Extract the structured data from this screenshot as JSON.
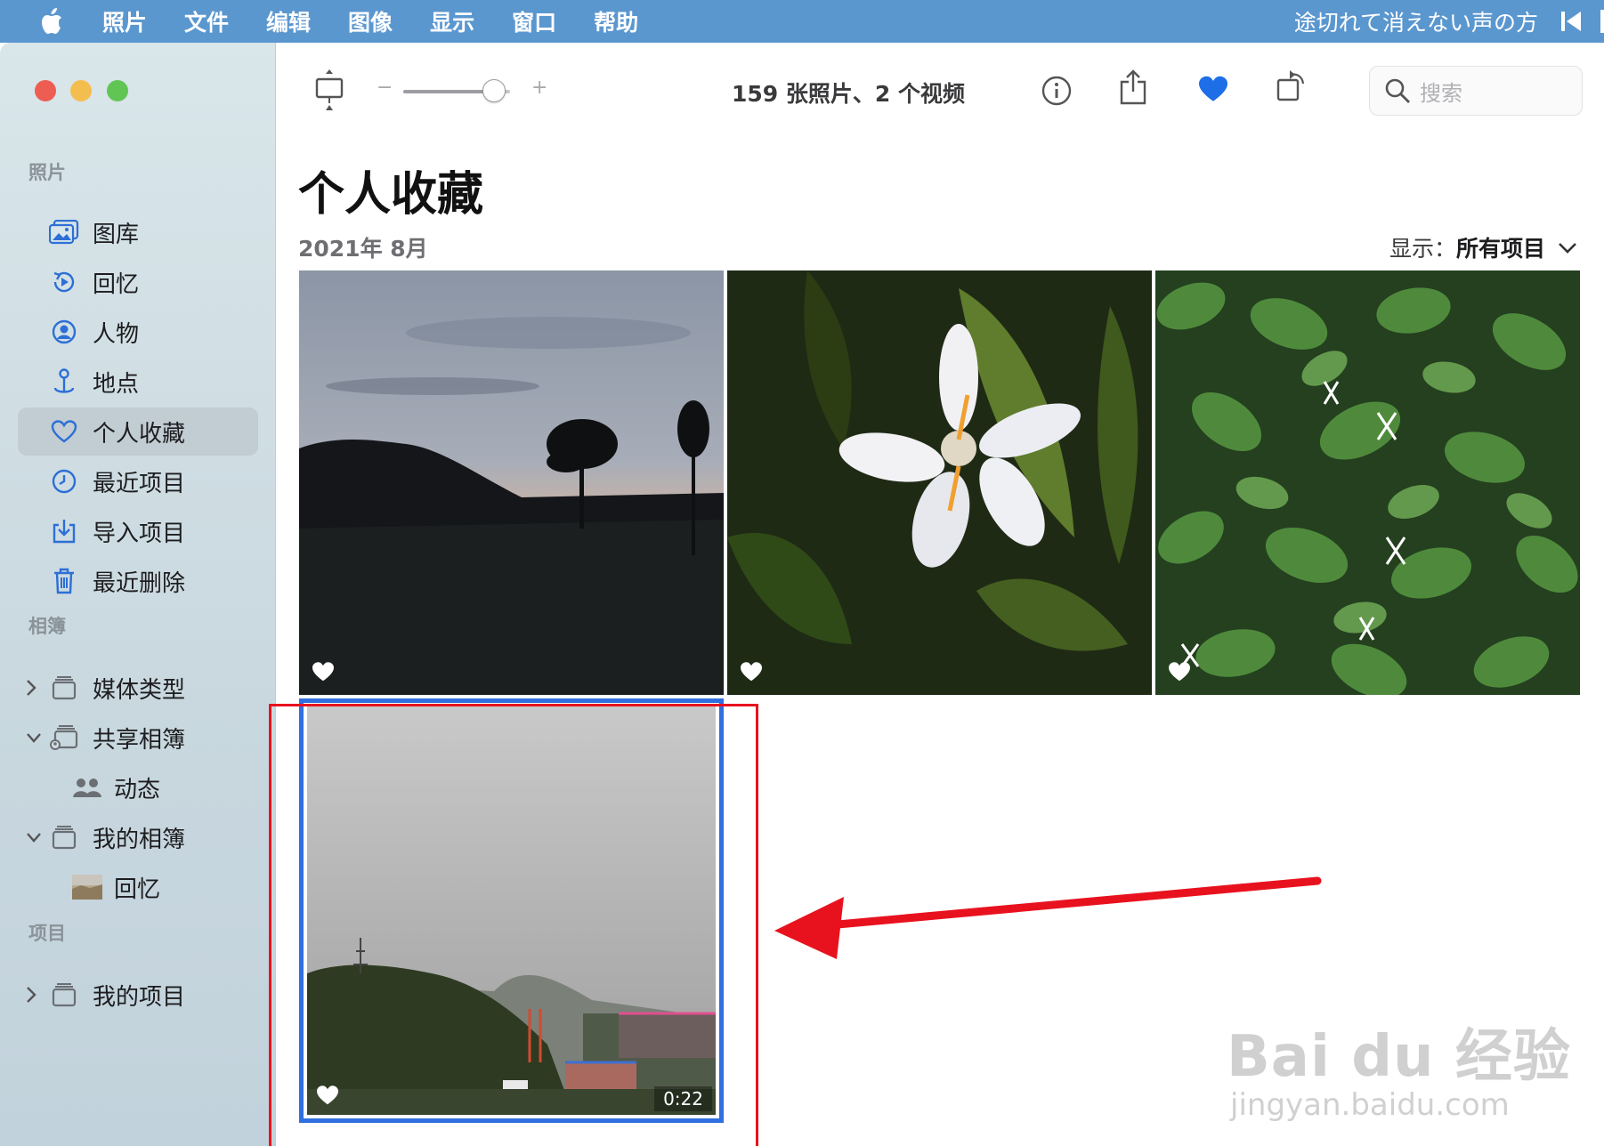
{
  "menubar": {
    "items": [
      "照片",
      "文件",
      "编辑",
      "图像",
      "显示",
      "窗口",
      "帮助"
    ],
    "now_playing": "途切れて消えない声の方"
  },
  "sidebar": {
    "section_photos": "照片",
    "photos": [
      "图库",
      "回忆",
      "人物",
      "地点",
      "个人收藏",
      "最近项目",
      "导入项目",
      "最近删除"
    ],
    "selected": "个人收藏",
    "section_albums": "相簿",
    "albums": {
      "media_types": "媒体类型",
      "shared": "共享相簿",
      "activity": "动态",
      "my_albums": "我的相簿",
      "memories": "回忆"
    },
    "section_projects": "项目",
    "my_projects": "我的项目"
  },
  "toolbar": {
    "minus": "−",
    "plus": "+",
    "zoom_level": 0.85,
    "count": "159 张照片、2 个视频",
    "search_placeholder": "搜索"
  },
  "content": {
    "title": "个人收藏",
    "date": "2021年 8月",
    "filter_label": "显示：",
    "filter_value": "所有项目",
    "video_duration": "0:22"
  },
  "watermark": {
    "brand": "Bai du 经验",
    "url": "jingyan.baidu.com"
  },
  "colors": {
    "menubar": "#5b97cf",
    "accent": "#2f6fe0",
    "favorite": "#1e6ee8",
    "annotation": "#e8121e"
  }
}
